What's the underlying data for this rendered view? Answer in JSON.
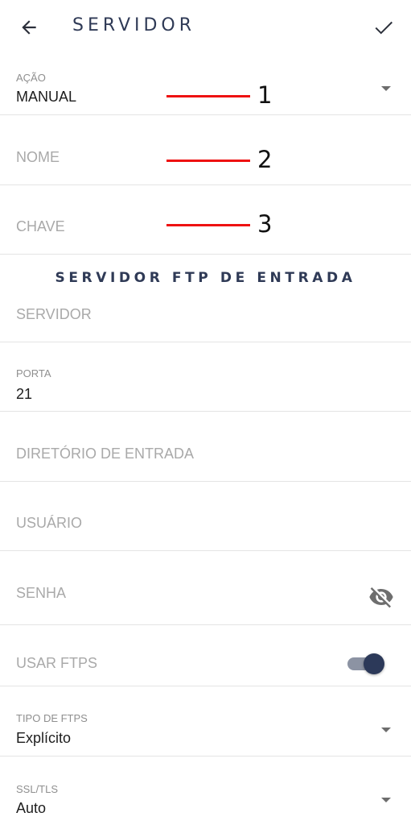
{
  "app_bar": {
    "title": "SERVIDOR",
    "back_icon": "arrow-left-icon",
    "confirm_icon": "check-icon"
  },
  "fields": {
    "acao": {
      "label": "AÇÃO",
      "value": "MANUAL"
    },
    "nome": {
      "placeholder": "NOME"
    },
    "chave": {
      "placeholder": "CHAVE"
    }
  },
  "annotations": [
    "1",
    "2",
    "3"
  ],
  "section": {
    "title": "SERVIDOR FTP DE ENTRADA"
  },
  "ftp": {
    "servidor": {
      "placeholder": "SERVIDOR"
    },
    "porta": {
      "label": "PORTA",
      "value": "21"
    },
    "diretorio": {
      "placeholder": "DIRETÓRIO DE ENTRADA"
    },
    "usuario": {
      "placeholder": "USUÁRIO"
    },
    "senha": {
      "placeholder": "SENHA",
      "visibility_icon": "eye-off-icon"
    },
    "usar_ftps": {
      "label": "USAR FTPS",
      "enabled": true
    },
    "tipo_ftps": {
      "label": "TIPO DE FTPS",
      "value": "Explícito"
    },
    "ssl_tls": {
      "label": "SSL/TLS",
      "value": "Auto"
    }
  },
  "colors": {
    "accent": "#2f3a56",
    "annotation_line": "#ee1111",
    "toggle_thumb": "#2c3959",
    "toggle_track": "#8c93a3"
  }
}
